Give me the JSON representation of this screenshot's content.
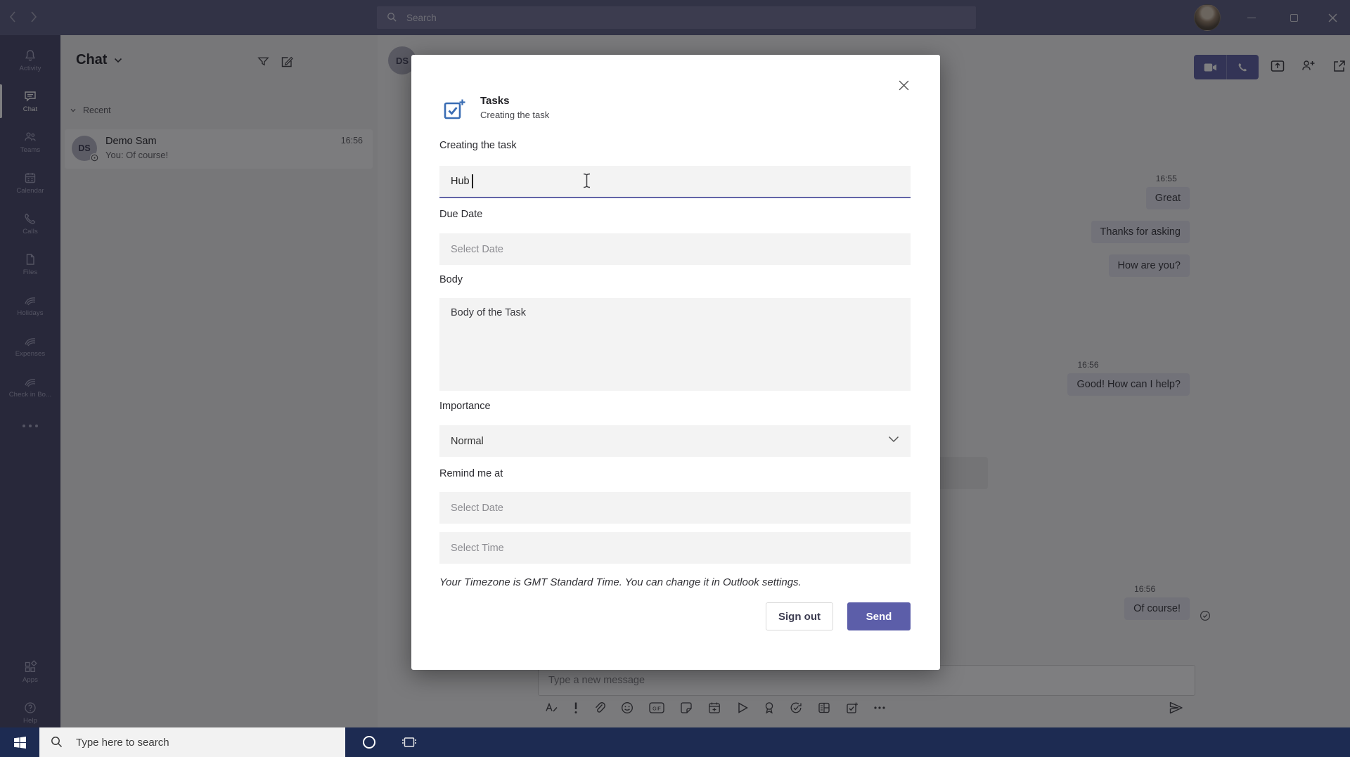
{
  "titlebar": {
    "search_placeholder": "Search"
  },
  "sidebar": {
    "items": [
      {
        "label": "Activity"
      },
      {
        "label": "Chat",
        "active": true
      },
      {
        "label": "Teams"
      },
      {
        "label": "Calendar"
      },
      {
        "label": "Calls"
      },
      {
        "label": "Files"
      },
      {
        "label": "Holidays"
      },
      {
        "label": "Expenses"
      },
      {
        "label": "Check in Bo..."
      },
      {
        "label": "Apps"
      },
      {
        "label": "Help"
      }
    ]
  },
  "chat_list": {
    "title": "Chat",
    "section": "Recent",
    "conversation": {
      "initials": "DS",
      "name": "Demo Sam",
      "preview": "You: Of course!",
      "time": "16:56"
    }
  },
  "conversation": {
    "header_initials": "DS",
    "messages": [
      {
        "time": "16:55",
        "text": "Great"
      },
      {
        "text": "Thanks for asking"
      },
      {
        "text": "How are you?"
      },
      {
        "time": "16:56",
        "text": "Good! How can I help?"
      },
      {
        "time": "16:56",
        "text": "Of course!",
        "status": "sent"
      }
    ]
  },
  "compose": {
    "placeholder": "Type a new message",
    "gif_label": "GIF"
  },
  "modal": {
    "app_name": "Tasks",
    "app_subtitle": "Creating the task",
    "fields": {
      "title": {
        "label": "Creating the task",
        "value": "Hub"
      },
      "due_date": {
        "label": "Due Date",
        "placeholder": "Select Date"
      },
      "body": {
        "label": "Body",
        "value": "Body of the Task"
      },
      "importance": {
        "label": "Importance",
        "value": "Normal"
      },
      "remind": {
        "label": "Remind me at",
        "date_placeholder": "Select Date",
        "time_placeholder": "Select Time"
      }
    },
    "note": "Your Timezone is GMT Standard Time. You can change it in Outlook settings.",
    "buttons": {
      "sign_out": "Sign out",
      "send": "Send"
    }
  },
  "taskbar": {
    "search_placeholder": "Type here to search"
  },
  "colors": {
    "accent": "#6264a7",
    "taskbar": "#1d2b52",
    "task_icon_blue": "#3a6db4"
  }
}
